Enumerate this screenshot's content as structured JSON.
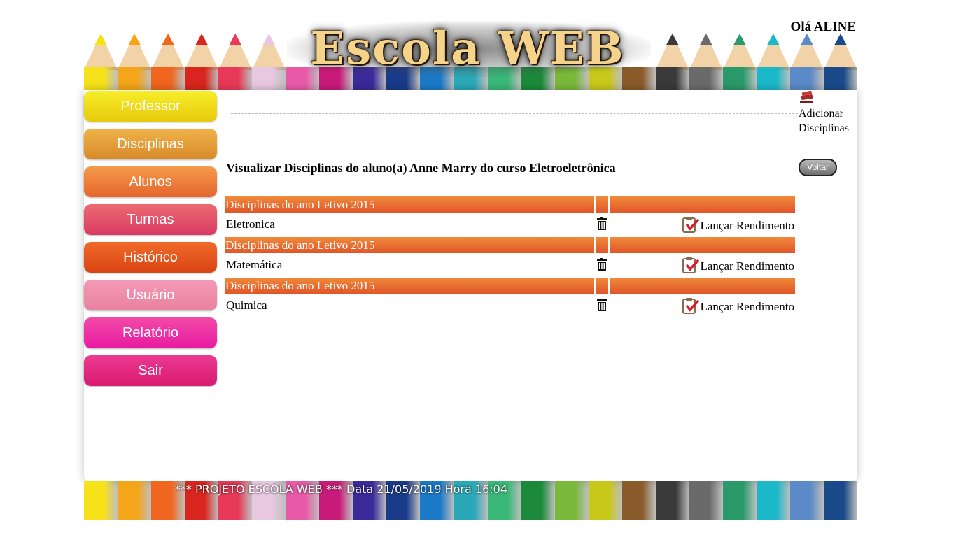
{
  "header": {
    "logo_text": "Escola WEB",
    "greeting": "Olá ALINE"
  },
  "sidebar": {
    "items": [
      {
        "label": "Professor",
        "color_top": "#f7ee2a",
        "color_bottom": "#e9c90d"
      },
      {
        "label": "Disciplinas",
        "color_top": "#f0b24a",
        "color_bottom": "#d88a2a"
      },
      {
        "label": "Alunos",
        "color_top": "#f59a4a",
        "color_bottom": "#e5652e"
      },
      {
        "label": "Turmas",
        "color_top": "#ec6a72",
        "color_bottom": "#d93a62"
      },
      {
        "label": "Histórico",
        "color_top": "#f06a2a",
        "color_bottom": "#d94412"
      },
      {
        "label": "Usuário",
        "color_top": "#f49ab8",
        "color_bottom": "#e8829e"
      },
      {
        "label": "Relatório",
        "color_top": "#f24aa8",
        "color_bottom": "#e81aa0"
      },
      {
        "label": "Sair",
        "color_top": "#ec3a92",
        "color_bottom": "#d81a70"
      }
    ]
  },
  "content": {
    "add_label": "Adicionar Disciplinas",
    "title": "Visualizar Disciplinas do aluno(a) Anne Marry do curso Eletroeletrônica",
    "back_button": "Voltar",
    "groups": [
      {
        "header": "Disciplinas do ano Letivo 2015",
        "discipline": "Eletronica",
        "action": "Lançar Rendimento"
      },
      {
        "header": "Disciplinas do ano Letivo 2015",
        "discipline": "Matemática",
        "action": "Lançar Rendimento"
      },
      {
        "header": "Disciplinas do ano Letivo 2015",
        "discipline": "Quimica",
        "action": "Lançar Rendimento"
      }
    ]
  },
  "footer": {
    "text": "*** PROJETO ESCOLA WEB *** Data 21/05/2019 Hora 16:04"
  },
  "colors": {
    "accent_orange": "#e86a30",
    "pencils": [
      "#f7e21a",
      "#f5a51a",
      "#f0661e",
      "#d8261e",
      "#e83a58",
      "#e8c8e0",
      "#e85aa8",
      "#c81a78",
      "#3a2a9a",
      "#1a3a8a",
      "#1a7ac8",
      "#2aa8b8",
      "#3ab878",
      "#1a8a3a",
      "#7ab83a",
      "#c8c81a",
      "#8a5a2a",
      "#3a3a3a",
      "#6a6a6a",
      "#2a9a6a",
      "#1ab8c8",
      "#5a8ac8",
      "#1a4a8a"
    ]
  }
}
